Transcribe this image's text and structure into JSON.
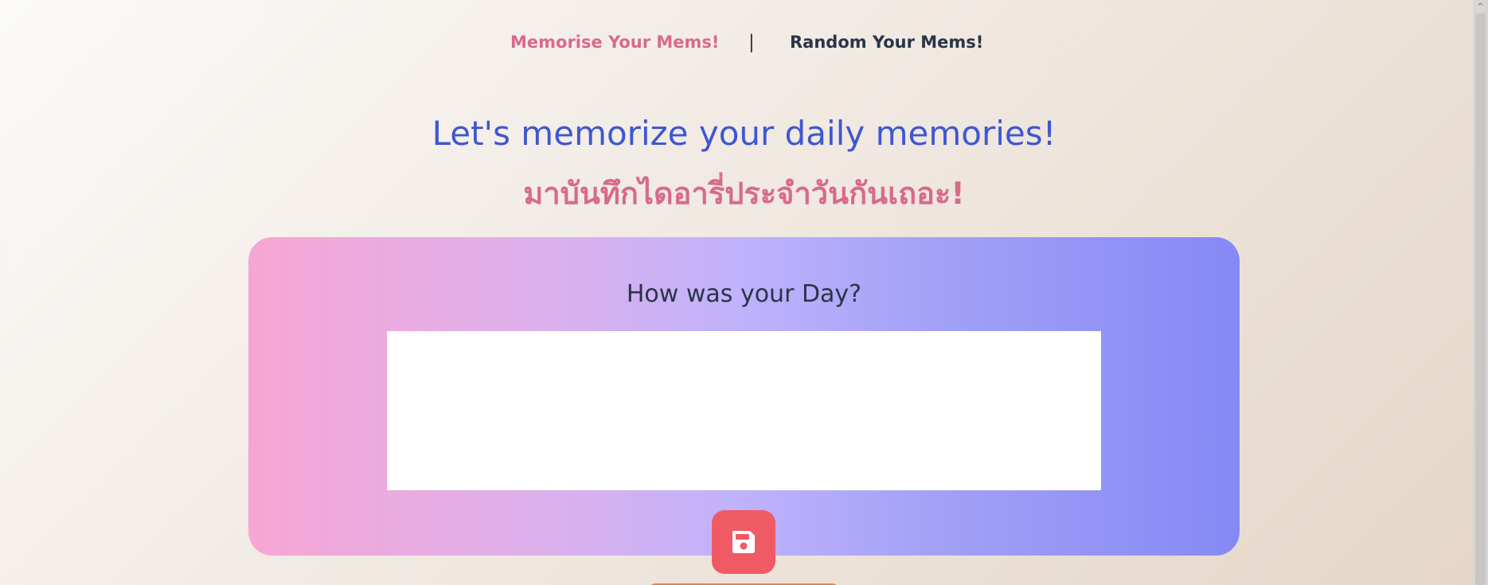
{
  "nav": {
    "memorise_label": "Memorise Your Mems!",
    "separator": "|",
    "random_label": "Random Your Mems!"
  },
  "hero": {
    "title": "Let's memorize your daily memories!",
    "title_thai": "มาบันทึกไดอารี่ประจำวันกันเถอะ!"
  },
  "card": {
    "question": "How was your Day?",
    "diary_value": "",
    "save_icon": "floppy-disk-icon"
  },
  "colors": {
    "accent_pink": "#d86a8c",
    "heading_blue": "#3f57cf",
    "save_button": "#f05a64",
    "dark_text": "#2d3446"
  }
}
